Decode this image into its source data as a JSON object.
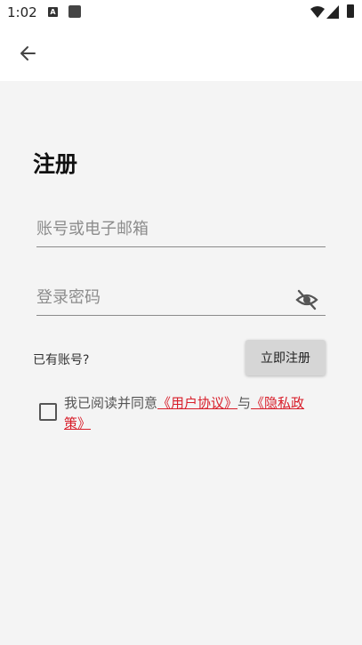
{
  "status_bar": {
    "time": "1:02",
    "notification_badge": "A",
    "icons": [
      "a-notification-icon",
      "app-notification-icon",
      "wifi-icon",
      "signal-icon",
      "battery-icon"
    ]
  },
  "app_bar": {
    "back_icon": "arrow-left-icon"
  },
  "page": {
    "title": "注册",
    "account_placeholder": "账号或电子邮箱",
    "password_placeholder": "登录密码",
    "eye_icon": "eye-off-icon",
    "have_account": "已有账号?",
    "register_button": "立即注册",
    "agree_prefix": "我已阅读并同意",
    "user_agreement": "《用户协议》",
    "and": "与",
    "privacy_policy": "《隐私政策》",
    "checkbox_checked": false
  },
  "colors": {
    "content_bg": "#f4f4f4",
    "link": "#d81e2a",
    "button_bg": "#d6d6d6"
  }
}
